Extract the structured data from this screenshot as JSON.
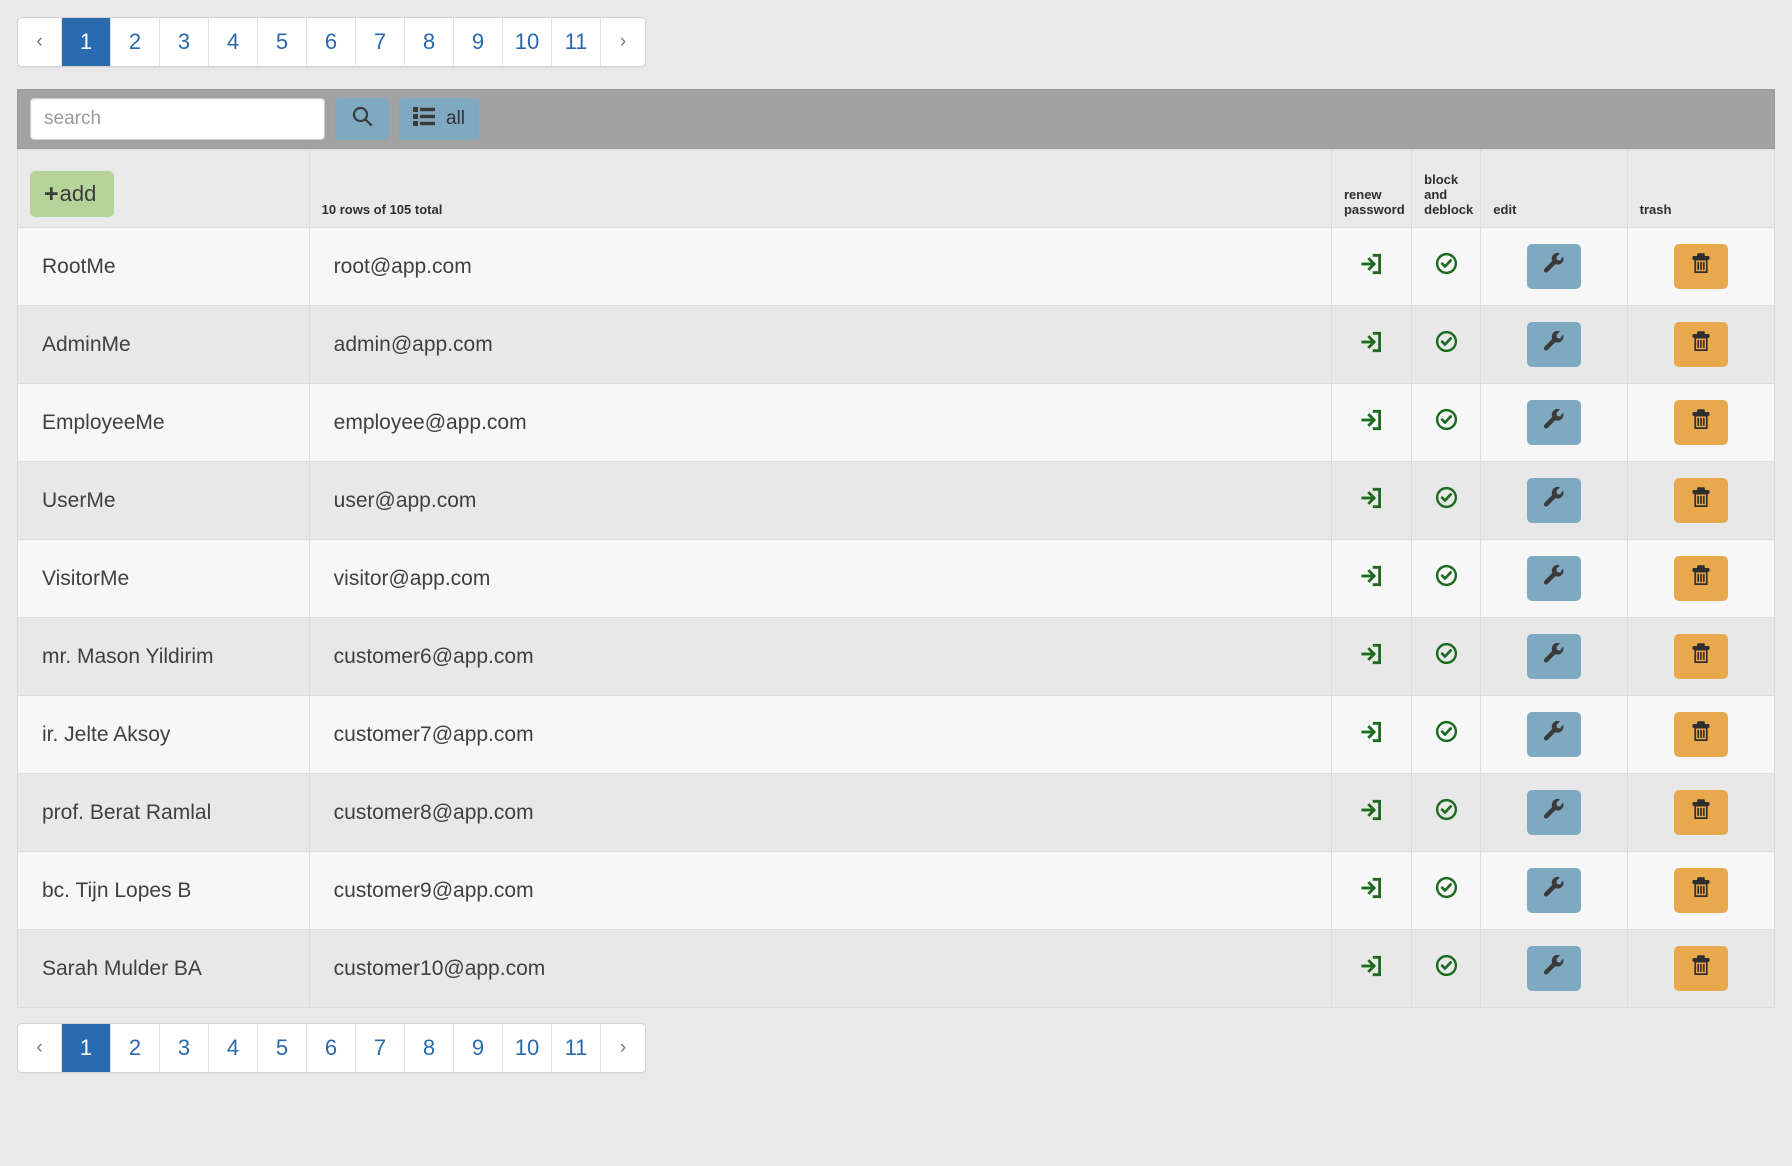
{
  "pagination": {
    "prev_label": "‹",
    "next_label": "›",
    "pages": [
      "1",
      "2",
      "3",
      "4",
      "5",
      "6",
      "7",
      "8",
      "9",
      "10",
      "11"
    ],
    "active_page": "1"
  },
  "toolbar": {
    "search_placeholder": "search",
    "search_value": "",
    "search_icon": "search-icon",
    "list_icon": "list-icon",
    "all_label": "all"
  },
  "table": {
    "add_label": "add",
    "add_plus": "+",
    "rows_summary": "10 rows of 105 total",
    "headers": {
      "name": "",
      "email": "",
      "renew_password": [
        "renew",
        "password"
      ],
      "block_deblock": [
        "block",
        "and",
        "deblock"
      ],
      "edit": "edit",
      "trash": "trash"
    },
    "row_icons": {
      "renew_password": "sign-in-icon",
      "block_deblock": "check-circle-icon",
      "edit": "wrench-icon",
      "trash": "trash-icon"
    },
    "rows": [
      {
        "name": "RootMe",
        "email": "root@app.com"
      },
      {
        "name": "AdminMe",
        "email": "admin@app.com"
      },
      {
        "name": "EmployeeMe",
        "email": "employee@app.com"
      },
      {
        "name": "UserMe",
        "email": "user@app.com"
      },
      {
        "name": "VisitorMe",
        "email": "visitor@app.com"
      },
      {
        "name": "mr. Mason Yildirim",
        "email": "customer6@app.com"
      },
      {
        "name": "ir. Jelte Aksoy",
        "email": "customer7@app.com"
      },
      {
        "name": "prof. Berat Ramlal",
        "email": "customer8@app.com"
      },
      {
        "name": "bc. Tijn Lopes B",
        "email": "customer9@app.com"
      },
      {
        "name": "Sarah Mulder BA",
        "email": "customer10@app.com"
      }
    ]
  },
  "colors": {
    "page_bg": "#e9e9e9",
    "active_page": "#2a6bb0",
    "toolbar_bg": "#a2a2a2",
    "button_blue": "#7fa8c1",
    "add_green": "#b6d39a",
    "trash_orange": "#e8a94e",
    "icon_green": "#1b6b21"
  }
}
